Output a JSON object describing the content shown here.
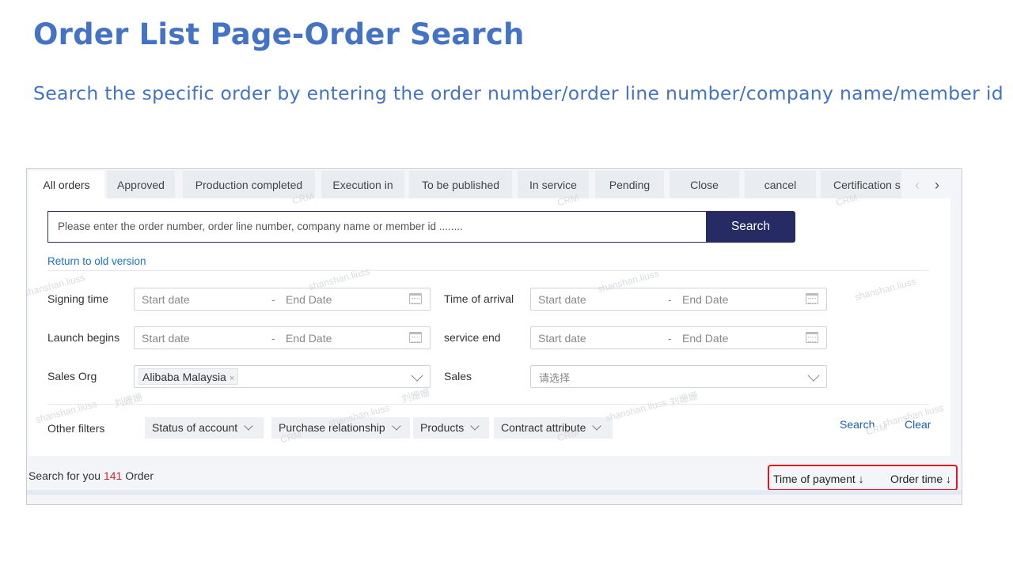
{
  "slide": {
    "title": "Order List Page-Order Search",
    "subtitle": "Search the specific order by entering the order number/order line number/company name/member id"
  },
  "tabs": [
    {
      "label": "All orders",
      "active": true
    },
    {
      "label": "Approved"
    },
    {
      "label": "Production completed"
    },
    {
      "label": "Execution in"
    },
    {
      "label": "To be published"
    },
    {
      "label": "In service"
    },
    {
      "label": "Pending"
    },
    {
      "label": "Close"
    },
    {
      "label": "cancel"
    },
    {
      "label": "Certification s"
    }
  ],
  "tab_arrows": {
    "prev": "‹",
    "next": "›"
  },
  "search": {
    "placeholder": "Please enter the order number, order line number, company name or member id ........",
    "button": "Search"
  },
  "old_version_link": "Return to old version",
  "fields": {
    "signing_time": {
      "label": "Signing time",
      "start": "Start date",
      "sep": "-",
      "end": "End Date"
    },
    "time_of_arrival": {
      "label": "Time of arrival",
      "start": "Start date",
      "sep": "-",
      "end": "End Date"
    },
    "launch_begins": {
      "label": "Launch begins",
      "start": "Start date",
      "sep": "-",
      "end": "End Date"
    },
    "service_end": {
      "label": "service end",
      "start": "Start date",
      "sep": "-",
      "end": "End Date"
    },
    "sales_org": {
      "label": "Sales Org",
      "tag": "Alibaba Malaysia",
      "tag_close": "×"
    },
    "sales": {
      "label": "Sales",
      "placeholder": "请选择"
    }
  },
  "other_filters": {
    "label": "Other filters",
    "items": [
      "Status of account",
      "Purchase relationship",
      "Products",
      "Contract attribute"
    ],
    "search_link": "Search",
    "clear_link": "Clear"
  },
  "result": {
    "prefix": "Search for you",
    "count": "141",
    "suffix": "Order"
  },
  "sort": {
    "payment": "Time of payment ↓",
    "order": "Order time ↓"
  },
  "watermark": {
    "name": "shanshan.liuss",
    "cn": "刘姗姗",
    "tag": "CRM"
  },
  "colors": {
    "accent": "#4472c4",
    "button": "#262b63",
    "link": "#1a73c8",
    "highlight": "#e0161e",
    "count": "#e0202a"
  }
}
